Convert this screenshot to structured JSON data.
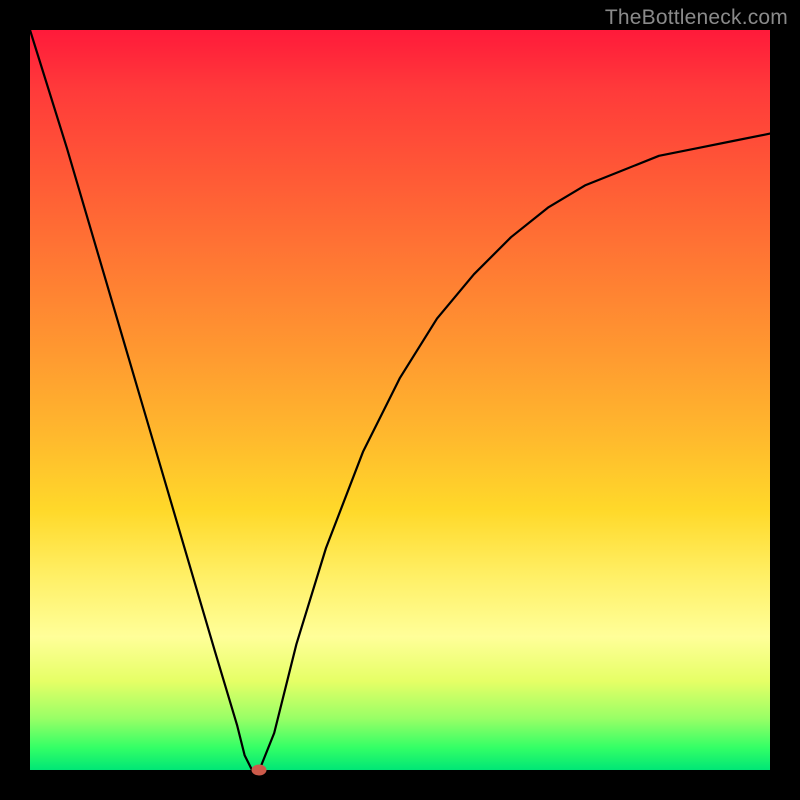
{
  "watermark": "TheBottleneck.com",
  "chart_data": {
    "type": "line",
    "title": "",
    "xlabel": "",
    "ylabel": "",
    "xlim": [
      0,
      100
    ],
    "ylim": [
      0,
      100
    ],
    "grid": false,
    "legend": false,
    "series": [
      {
        "name": "curve",
        "x": [
          0,
          5,
          10,
          15,
          20,
          25,
          28,
          29,
          30,
          31,
          33,
          36,
          40,
          45,
          50,
          55,
          60,
          65,
          70,
          75,
          80,
          85,
          90,
          95,
          100
        ],
        "y": [
          100,
          84,
          67,
          50,
          33,
          16,
          6,
          2,
          0,
          0,
          5,
          17,
          30,
          43,
          53,
          61,
          67,
          72,
          76,
          79,
          81,
          83,
          84,
          85,
          86
        ]
      }
    ],
    "marker": {
      "x": 31,
      "y": 0
    },
    "gradient_stops": [
      {
        "pos": 0,
        "color": "#ff1a3a"
      },
      {
        "pos": 50,
        "color": "#ffb92d"
      },
      {
        "pos": 82,
        "color": "#ffff99"
      },
      {
        "pos": 100,
        "color": "#00e676"
      }
    ]
  }
}
